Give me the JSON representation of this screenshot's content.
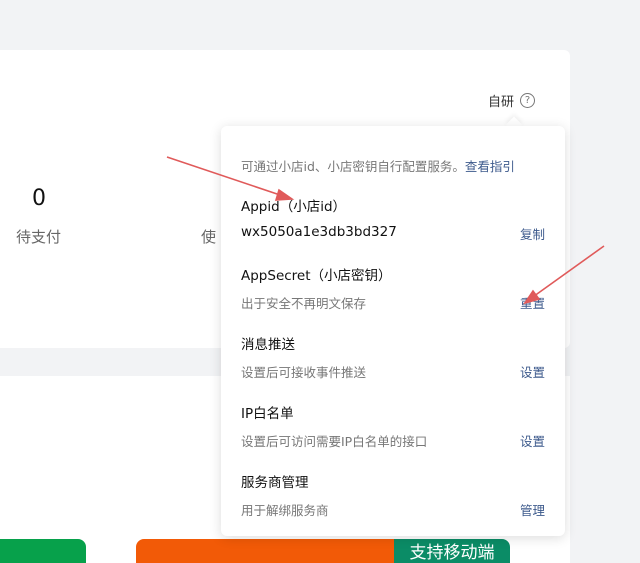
{
  "header": {
    "dev_mode_label": "自研",
    "help_icon": "?"
  },
  "stats": {
    "pending_pay_value": "0",
    "pending_pay_label": "待支付",
    "partial_label": "使"
  },
  "bottom": {
    "mobile_support_label": "支持移动端"
  },
  "popover": {
    "intro": "可通过小店id、小店密钥自行配置服务。",
    "guide_link": "查看指引",
    "sections": [
      {
        "title": "Appid（小店id）",
        "value": "wx5050a1e3db3bd327",
        "action": "复制"
      },
      {
        "title": "AppSecret（小店密钥）",
        "subtitle": "出于安全不再明文保存",
        "action": "重置"
      },
      {
        "title": "消息推送",
        "subtitle": "设置后可接收事件推送",
        "action": "设置"
      },
      {
        "title": "IP白名单",
        "subtitle": "设置后可访问需要IP白名单的接口",
        "action": "设置"
      },
      {
        "title": "服务商管理",
        "subtitle": "用于解绑服务商",
        "action": "管理"
      }
    ]
  },
  "colors": {
    "link": "#3d5a8c",
    "annotation_arrow": "#e05a5a",
    "green_button": "#07a14b",
    "orange_button": "#f25a07",
    "teal_button": "#0b8c66"
  }
}
